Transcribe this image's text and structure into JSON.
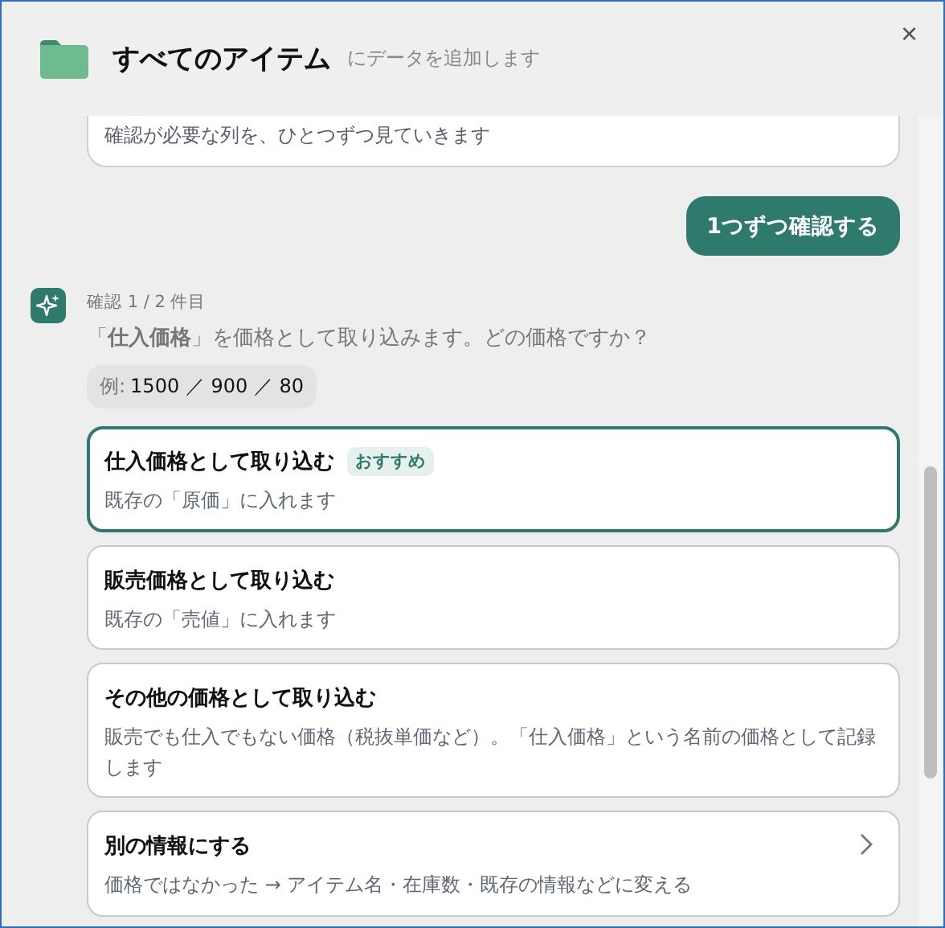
{
  "header": {
    "title": "すべてのアイテム",
    "subtitle": "にデータを追加します",
    "close": "×"
  },
  "previous_message": "確認が必要な列を、ひとつずつ見ていきます",
  "reply_button": "1つずつ確認する",
  "question": {
    "progress": "確認 1 / 2 件目",
    "text": "「**仕入価格**」を価格として取り込みます。どの価格ですか？",
    "example_label": "例:",
    "example_values": "1500 ／ 900 ／ 80"
  },
  "options": [
    {
      "kind": "choice",
      "title": "仕入価格として取り込む",
      "badge": "おすすめ",
      "description": "既存の「原価」に入れます",
      "selected": true
    },
    {
      "kind": "choice",
      "title": "販売価格として取り込む",
      "description": "既存の「売値」に入れます",
      "selected": false
    },
    {
      "kind": "choice",
      "title": "その他の価格として取り込む",
      "description": "販売でも仕入でもない価格（税抜単価など）。「仕入価格」という名前の価格として記録します",
      "selected": false
    },
    {
      "kind": "nav",
      "title": "別の情報にする",
      "description": "価格ではなかった → アイテム名・在庫数・既存の情報などに変える",
      "selected": false
    }
  ]
}
